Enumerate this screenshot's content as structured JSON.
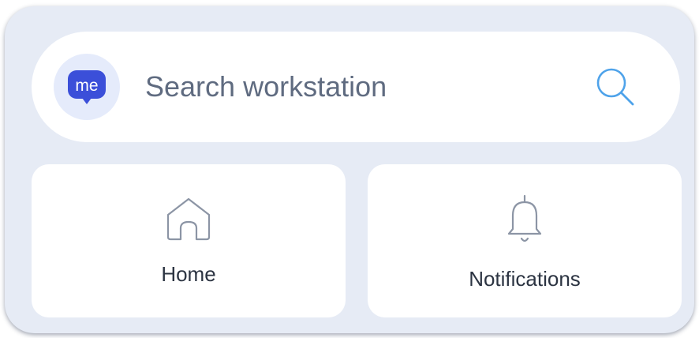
{
  "logo": {
    "text": "me",
    "color": "#3b4fd9"
  },
  "search": {
    "placeholder": "Search workstation",
    "value": "",
    "icon": "search-icon"
  },
  "tiles": [
    {
      "label": "Home",
      "icon": "home-icon"
    },
    {
      "label": "Notifications",
      "icon": "bell-icon"
    }
  ],
  "colors": {
    "panel": "#e6ebf5",
    "card": "#ffffff",
    "accent": "#4fa3ea",
    "text": "#2c3442",
    "placeholder": "#5f6b80"
  }
}
